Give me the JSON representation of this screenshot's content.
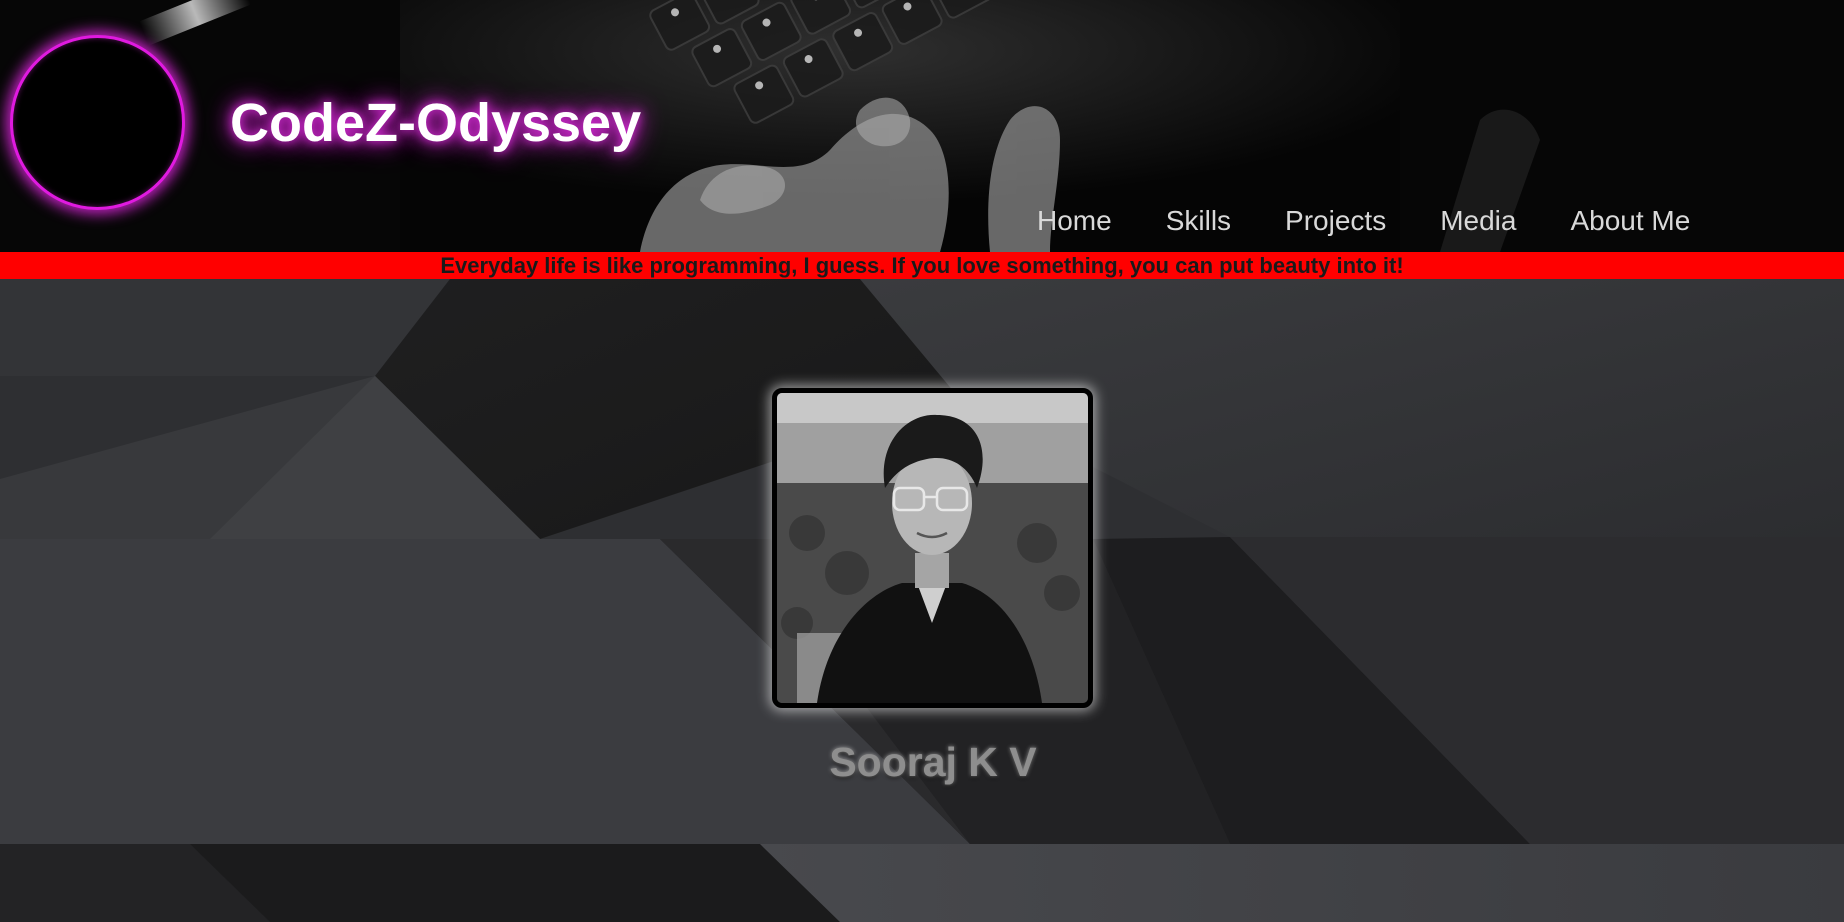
{
  "header": {
    "title": "CodeZ-Odyssey",
    "accent_color": "#e01ae0",
    "logo_icon": "logo-circle-icon"
  },
  "nav": {
    "items": [
      {
        "label": "Home"
      },
      {
        "label": "Skills"
      },
      {
        "label": "Projects"
      },
      {
        "label": "Media"
      },
      {
        "label": "About Me"
      }
    ]
  },
  "quote": {
    "text": "Everyday life is like programming, I guess. If you love something, you can put beauty into it!",
    "bar_color": "#ff0000"
  },
  "profile": {
    "name": "Sooraj K V",
    "photo_icon": "profile-photo"
  }
}
